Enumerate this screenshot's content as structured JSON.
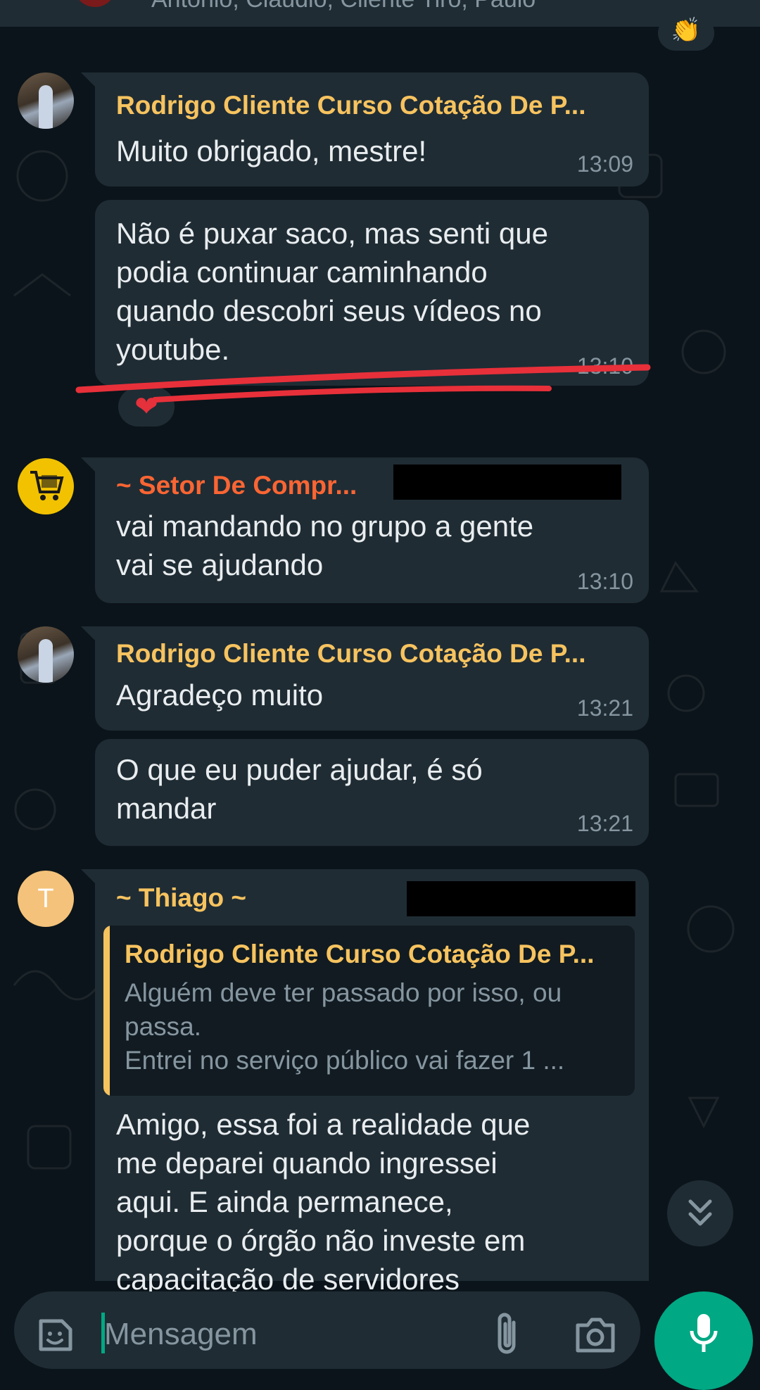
{
  "header": {
    "members_clip": "Antonio, Claudio, Cliente Tiro, Paulo"
  },
  "messages": [
    {
      "sender": "Rodrigo Cliente Curso Cotação De P...",
      "text": "Muito obrigado, mestre!",
      "time": "13:09"
    },
    {
      "text": "Não é puxar saco, mas senti que\npodia continuar caminhando\nquando descobri seus vídeos no\nyoutube.",
      "time": "13:10",
      "reaction": "❤"
    },
    {
      "sender": "~ Setor De Compr...",
      "text": "vai mandando no grupo a gente\nvai se ajudando",
      "time": "13:10"
    },
    {
      "sender": "Rodrigo Cliente Curso Cotação De P...",
      "text": "Agradeço muito",
      "time": "13:21"
    },
    {
      "text": "O que eu puder ajudar, é só\nmandar",
      "time": "13:21"
    },
    {
      "sender": "~ Thiago ~",
      "avatar_letter": "T",
      "quote": {
        "sender": "Rodrigo Cliente Curso Cotação De P...",
        "text": "Alguém deve ter passado por isso, ou\npassa.\nEntrei no serviço público vai fazer 1 ..."
      },
      "text": "Amigo, essa foi a realidade que\nme deparei quando ingressei\naqui. E ainda permanece,\nporque o órgão não investe em\ncapacitação de servidores"
    }
  ],
  "composer": {
    "placeholder": "Mensagem"
  },
  "colors": {
    "background": "#0b141a",
    "bubble": "#1f2c34",
    "sender_gold": "#f7c35f",
    "sender_orange": "#fa6533",
    "accent_green": "#00a884",
    "annotation_red": "#e8303a"
  },
  "icons": [
    "emoji-sticker-icon",
    "attach-icon",
    "camera-icon",
    "mic-icon",
    "scroll-down-icon",
    "cart-logo-icon"
  ]
}
